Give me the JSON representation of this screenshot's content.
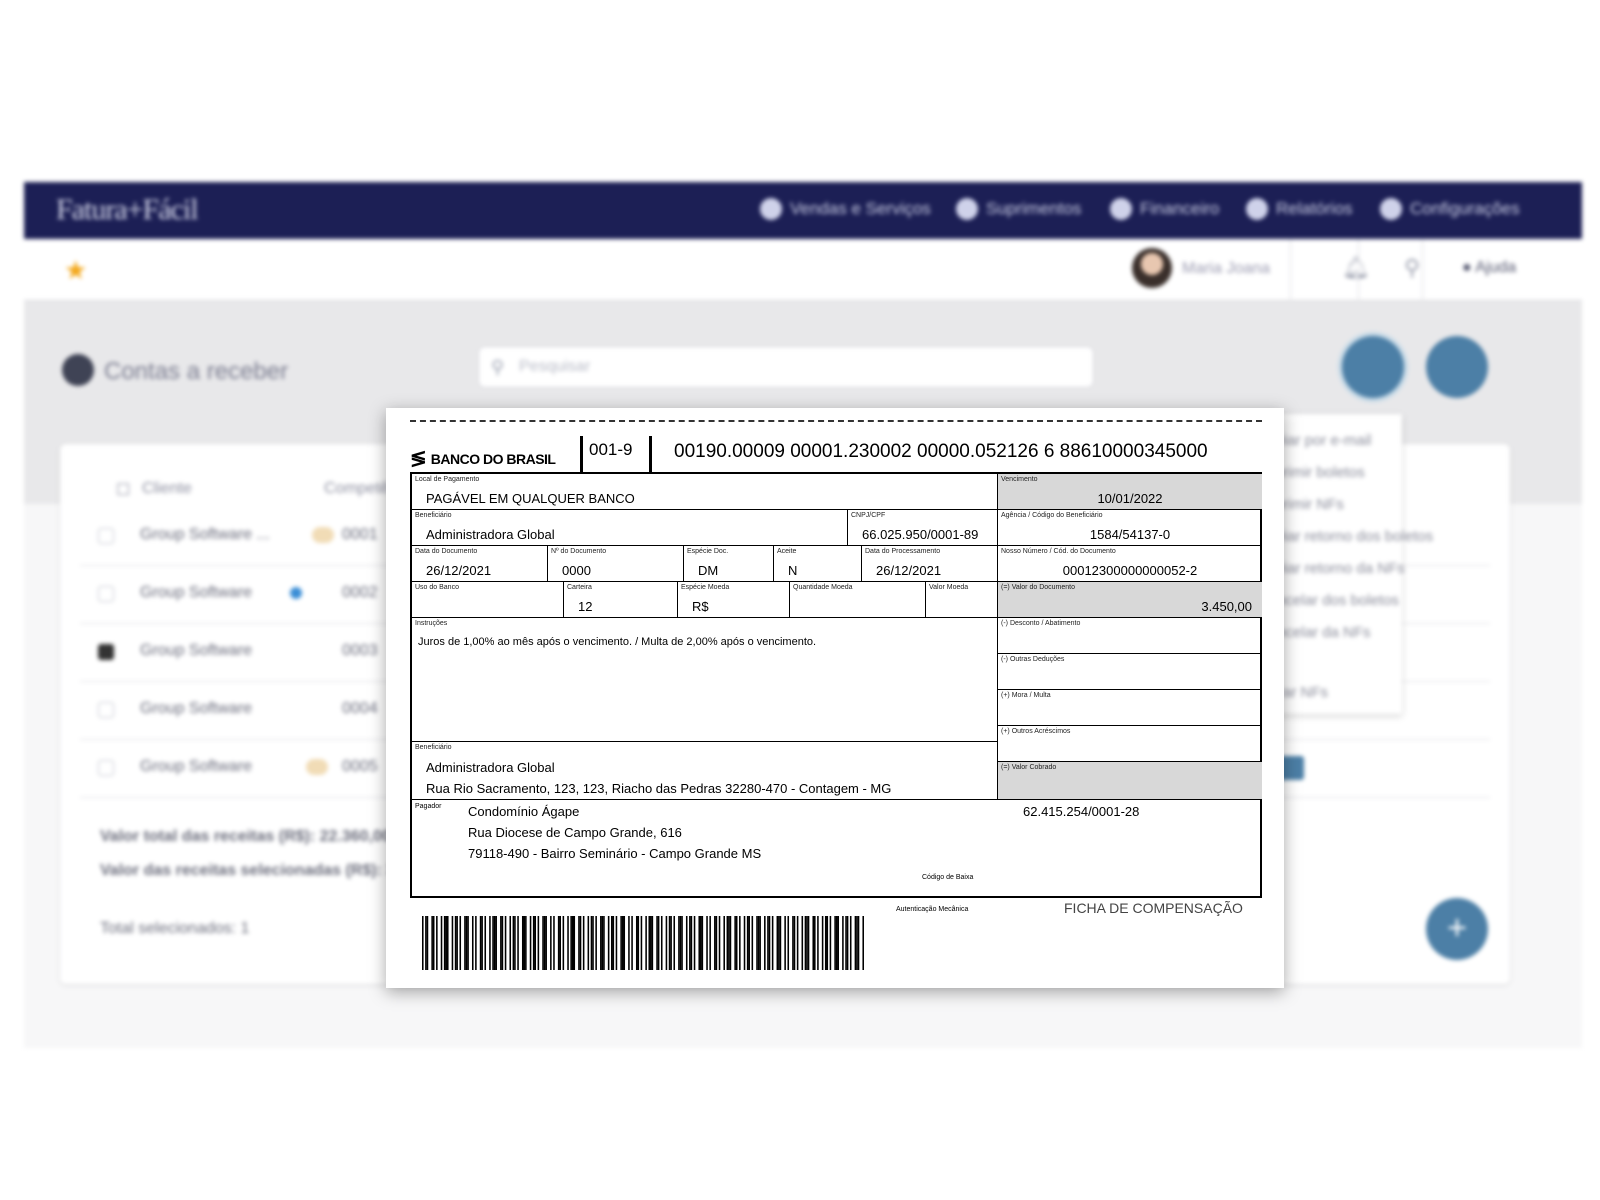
{
  "app": {
    "logo": "Fatura+Fácil",
    "nav": [
      "Vendas e Serviços",
      "Suprimentos",
      "Financeiro",
      "Relatórios",
      "Configurações"
    ],
    "user_name": "Maria Joana",
    "help_label": "Ajuda",
    "page_title": "Contas a receber",
    "search_placeholder": "Pesquisar",
    "list_headers": [
      "Cliente",
      "Competência"
    ],
    "rows": [
      {
        "name": "Group Software ...",
        "code": "0001"
      },
      {
        "name": "Group Software",
        "code": "0002"
      },
      {
        "name": "Group Software",
        "code": "0003"
      },
      {
        "name": "Group Software",
        "code": "0004"
      },
      {
        "name": "Group Software",
        "code": "0005"
      }
    ],
    "dropdown_items": [
      "Enviar por e-mail",
      "Imprimir boletos",
      "Imprimir NFs",
      "Enviar retorno dos boletos",
      "Enviar retorno da NFs",
      "Cancelar dos boletos",
      "Cancelar da NFs",
      "",
      "Gerar NFs"
    ],
    "footer": {
      "total_label": "Valor total das receitas (R$): 22.360,00",
      "selected_label": "Valor das receitas selecionadas (R$): 3.450,00",
      "count_label": "Total selecionados: 1"
    }
  },
  "boleto": {
    "bank_name": "BANCO DO BRASIL",
    "bank_code": "001-9",
    "digitable_line": "00190.00009  00001.230002  00000.052126  6  88610000345000",
    "fields": {
      "local_pagamento": {
        "label": "Local de Pagamento",
        "value": "PAGÁVEL EM QUALQUER BANCO"
      },
      "vencimento": {
        "label": "Vencimento",
        "value": "10/01/2022"
      },
      "beneficiario": {
        "label": "Beneficiário",
        "value": "Administradora Global"
      },
      "cnpj": {
        "label": "CNPJ/CPF",
        "value": "66.025.950/0001-89"
      },
      "agencia": {
        "label": "Agência / Código do Beneficiário",
        "value": "1584/54137-0"
      },
      "data_documento": {
        "label": "Data do Documento",
        "value": "26/12/2021"
      },
      "num_documento": {
        "label": "Nº do Documento",
        "value": "0000"
      },
      "especie_doc": {
        "label": "Espécie Doc.",
        "value": "DM"
      },
      "aceite": {
        "label": "Aceite",
        "value": "N"
      },
      "data_processamento": {
        "label": "Data do Processamento",
        "value": "26/12/2021"
      },
      "nosso_numero": {
        "label": "Nosso Número / Cód. do Documento",
        "value": "00012300000000052-2"
      },
      "uso_banco": {
        "label": "Uso do Banco",
        "value": ""
      },
      "carteira": {
        "label": "Carteira",
        "value": "12"
      },
      "especie_moeda": {
        "label": "Espécie Moeda",
        "value": "R$"
      },
      "quantidade_moeda": {
        "label": "Quantidade Moeda",
        "value": ""
      },
      "valor_moeda": {
        "label": "Valor Moeda",
        "value": ""
      },
      "valor_documento": {
        "label": "(=) Valor do Documento",
        "value": "3.450,00"
      },
      "instrucoes": {
        "label": "Instruções",
        "value": "Juros de 1,00% ao mês após o vencimento. / Multa de 2,00% após o vencimento."
      },
      "desconto": {
        "label": "(-) Desconto / Abatimento"
      },
      "outras_deducoes": {
        "label": "(-) Outras Deduções"
      },
      "mora_multa": {
        "label": "(+) Mora / Multa"
      },
      "outros_acrescimos": {
        "label": "(+) Outros Acréscimos"
      },
      "valor_cobrado": {
        "label": "(=) Valor Cobrado"
      },
      "beneficiario2": {
        "label": "Beneficiário",
        "name": "Administradora Global",
        "address": "Rua Rio Sacramento, 123, 123, Riacho das Pedras 32280-470 - Contagem - MG"
      }
    },
    "pagador": {
      "label": "Pagador",
      "name": "Condomínio Ágape",
      "street": "Rua Diocese de Campo Grande, 616",
      "city": "79118-490 - Bairro Seminário - Campo Grande MS",
      "document": "62.415.254/0001-28"
    },
    "codigo_baixa_label": "Código de Baixa",
    "autenticacao_label": "Autenticação Mecânica",
    "ficha_label": "FICHA DE COMPENSAÇÃO",
    "barcode_pattern": "1011001101001011100101101001110010100110100101110011010010110100111001011010011100101001101001011100110100101101001110010110100111001010011010010111001101001011010011100101101001110010100110100101110011010010110100111001011010011100101001101001011100110100101101001110010110100111001"
  }
}
